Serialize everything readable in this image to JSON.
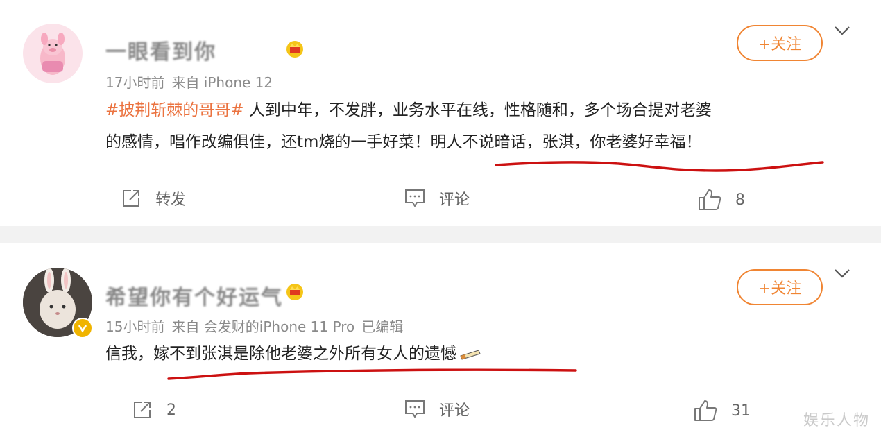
{
  "posts": [
    {
      "username": "一眼看到你",
      "meta": {
        "time": "17小时前",
        "source": "来自 iPhone 12",
        "edited": ""
      },
      "follow_label": "+关注",
      "hashtag": "#披荆斩棘的哥哥#",
      "body_line1": "人到中年，不发胖，业务水平在线，性格随和，多个场合提对老婆",
      "body_line2_a": "的感情，唱作改编俱佳，还tm烧的一手好菜！",
      "body_line2_b": "明人不说暗话，张淇，你老婆好幸福！",
      "actions": {
        "repost": "转发",
        "comment": "评论",
        "like": "8"
      }
    },
    {
      "username": "希望你有个好运气",
      "meta": {
        "time": "15小时前",
        "source": "来自 会发财的iPhone 11 Pro",
        "edited": "已编辑"
      },
      "follow_label": "+关注",
      "body_a": "信我，",
      "body_b": "嫁不到张淇是除他老婆之外所有女人的遗憾",
      "actions": {
        "repost": "2",
        "comment": "评论",
        "like": "31"
      }
    }
  ],
  "watermark": "娱乐人物",
  "colors": {
    "accent": "#f08533",
    "hashtag": "#eb7340",
    "underline": "#cc1111"
  }
}
